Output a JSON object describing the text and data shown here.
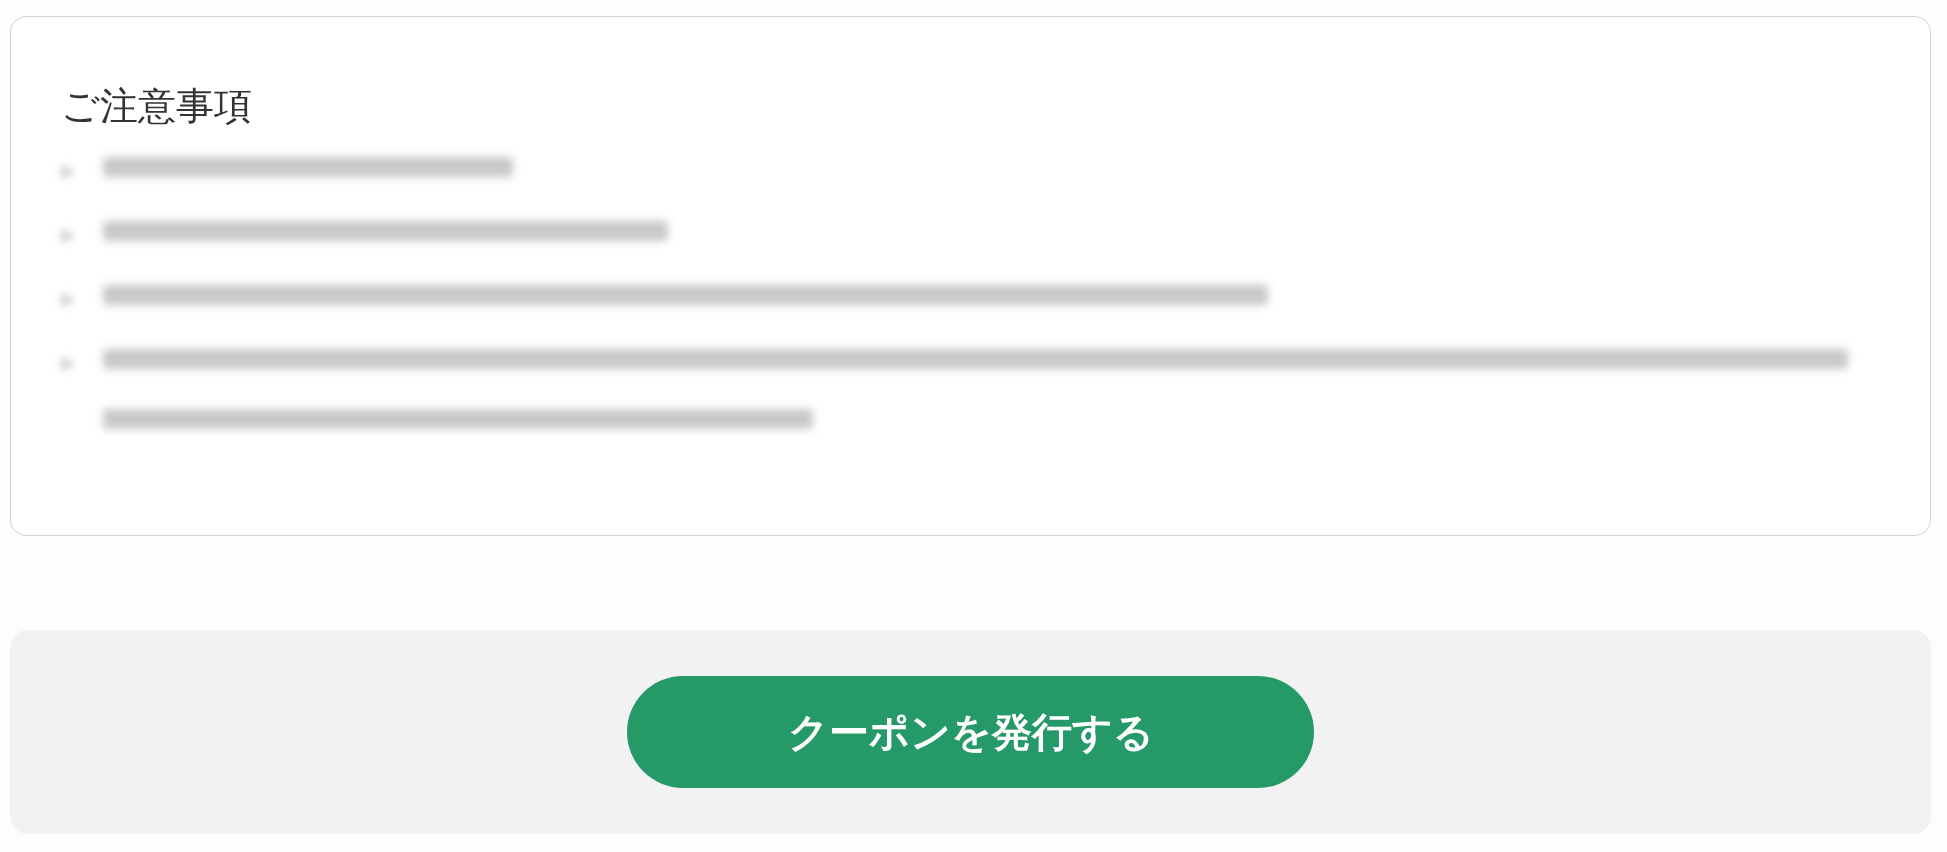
{
  "notice": {
    "title": "ご注意事項",
    "items": [
      {
        "kind": "redacted"
      },
      {
        "kind": "redacted"
      },
      {
        "kind": "redacted"
      },
      {
        "kind": "redacted"
      }
    ]
  },
  "footer": {
    "button": "クーポンを発行する"
  }
}
